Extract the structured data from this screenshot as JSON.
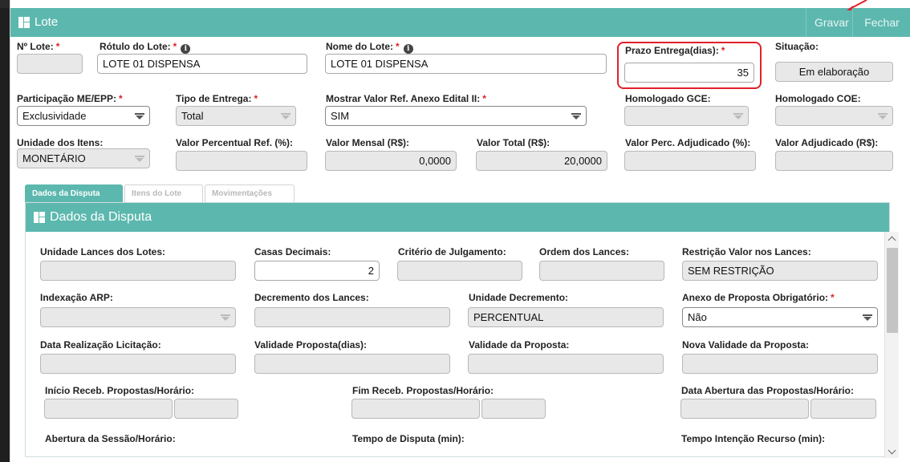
{
  "window": {
    "title": "Lote",
    "gravar": "Gravar",
    "fechar": "Fechar"
  },
  "row1": {
    "numero_lote": {
      "label": "Nº Lote:",
      "value": ""
    },
    "rotulo_lote": {
      "label": "Rótulo do Lote:",
      "value": "LOTE 01 DISPENSA"
    },
    "nome_lote": {
      "label": "Nome do Lote:",
      "value": "LOTE 01 DISPENSA"
    },
    "prazo_entrega": {
      "label": "Prazo Entrega(dias):",
      "value": "35"
    },
    "situacao": {
      "label": "Situação:",
      "value": "Em elaboração"
    }
  },
  "row2": {
    "participacao": {
      "label": "Participação ME/EPP:",
      "value": "Exclusividade"
    },
    "tipo_entrega": {
      "label": "Tipo de Entrega:",
      "value": "Total"
    },
    "mostrar_valor": {
      "label": "Mostrar Valor Ref. Anexo Edital II:",
      "value": "SIM"
    },
    "homologado_gce": {
      "label": "Homologado GCE:",
      "value": ""
    },
    "homologado_coe": {
      "label": "Homologado COE:",
      "value": ""
    }
  },
  "row3": {
    "unidade_itens": {
      "label": "Unidade dos Itens:",
      "value": "MONETÁRIO"
    },
    "valor_percentual_ref": {
      "label": "Valor Percentual Ref. (%):",
      "value": ""
    },
    "valor_mensal": {
      "label": "Valor Mensal (R$):",
      "value": "0,0000"
    },
    "valor_total": {
      "label": "Valor Total (R$):",
      "value": "20,0000"
    },
    "valor_perc_adjudicado": {
      "label": "Valor Perc. Adjudicado (%):",
      "value": ""
    },
    "valor_adjudicado": {
      "label": "Valor Adjudicado (R$):",
      "value": ""
    }
  },
  "tabs": [
    "Dados da Disputa",
    "Itens do Lote",
    "Movimentações"
  ],
  "panel": {
    "title": "Dados da Disputa",
    "unidade_lances": {
      "label": "Unidade Lances dos Lotes:",
      "value": ""
    },
    "casas_decimais": {
      "label": "Casas Decimais:",
      "value": "2"
    },
    "criterio_julgamento": {
      "label": "Critério de Julgamento:",
      "value": ""
    },
    "ordem_lances": {
      "label": "Ordem dos Lances:",
      "value": ""
    },
    "restricao_valor": {
      "label": "Restrição Valor nos Lances:",
      "value": "SEM RESTRIÇÃO"
    },
    "indexacao_arp": {
      "label": "Indexação ARP:",
      "value": ""
    },
    "decremento_lances": {
      "label": "Decremento dos Lances:",
      "value": ""
    },
    "unidade_decremento": {
      "label": "Unidade Decremento:",
      "value": "PERCENTUAL"
    },
    "anexo_proposta": {
      "label": "Anexo de Proposta Obrigatório:",
      "value": "Não"
    },
    "data_realizacao": {
      "label": "Data Realização Licitação:",
      "value": ""
    },
    "validade_proposta_dias": {
      "label": "Validade Proposta(dias):",
      "value": ""
    },
    "validade_proposta": {
      "label": "Validade da Proposta:",
      "value": ""
    },
    "nova_validade": {
      "label": "Nova Validade da Proposta:",
      "value": ""
    },
    "inicio_receb": {
      "label": "Início Receb. Propostas/Horário:"
    },
    "fim_receb": {
      "label": "Fim Receb. Propostas/Horário:"
    },
    "data_abertura": {
      "label": "Data Abertura das Propostas/Horário:"
    },
    "abertura_sessao": {
      "label": "Abertura da Sessão/Horário:"
    },
    "tempo_disputa": {
      "label": "Tempo de Disputa (min):"
    },
    "tempo_intencao": {
      "label": "Tempo Intenção Recurso (min):"
    }
  },
  "colors": {
    "accent": "#5cb8ae",
    "required": "#dd2222",
    "highlight": "#e0202a"
  }
}
